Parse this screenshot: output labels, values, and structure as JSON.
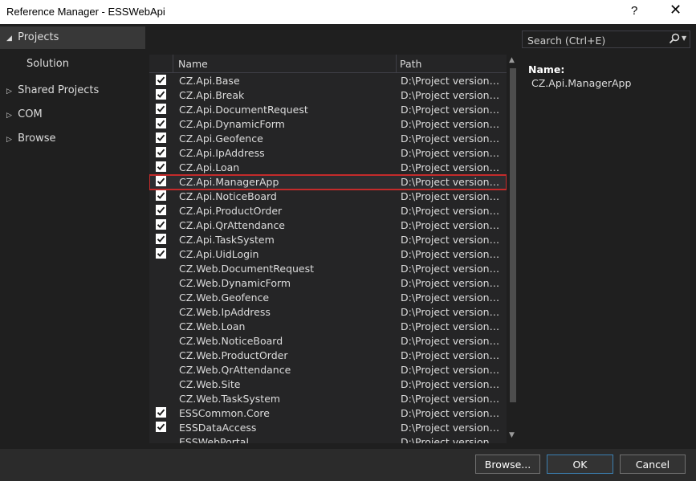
{
  "window": {
    "title": "Reference Manager - ESSWebApi",
    "help_glyph": "?",
    "close_glyph": "✕"
  },
  "sidebar": {
    "items": [
      {
        "label": "Projects",
        "expanded": true
      },
      {
        "label": "Solution"
      },
      {
        "label": "Shared Projects",
        "expanded": false
      },
      {
        "label": "COM",
        "expanded": false
      },
      {
        "label": "Browse",
        "expanded": false
      }
    ]
  },
  "search": {
    "placeholder": "Search (Ctrl+E)"
  },
  "grid": {
    "columns": {
      "name": "Name",
      "path": "Path"
    },
    "rows": [
      {
        "name": "CZ.Api.Base",
        "path": "D:\\Project versions\\...",
        "checked": true
      },
      {
        "name": "CZ.Api.Break",
        "path": "D:\\Project versions\\...",
        "checked": true
      },
      {
        "name": "CZ.Api.DocumentRequest",
        "path": "D:\\Project versions\\...",
        "checked": true
      },
      {
        "name": "CZ.Api.DynamicForm",
        "path": "D:\\Project versions\\...",
        "checked": true
      },
      {
        "name": "CZ.Api.Geofence",
        "path": "D:\\Project versions\\...",
        "checked": true
      },
      {
        "name": "CZ.Api.IpAddress",
        "path": "D:\\Project versions\\...",
        "checked": true
      },
      {
        "name": "CZ.Api.Loan",
        "path": "D:\\Project versions\\...",
        "checked": true
      },
      {
        "name": "CZ.Api.ManagerApp",
        "path": "D:\\Project versions\\...",
        "checked": true,
        "selected": true
      },
      {
        "name": "CZ.Api.NoticeBoard",
        "path": "D:\\Project versions\\...",
        "checked": true
      },
      {
        "name": "CZ.Api.ProductOrder",
        "path": "D:\\Project versions\\...",
        "checked": true
      },
      {
        "name": "CZ.Api.QrAttendance",
        "path": "D:\\Project versions\\...",
        "checked": true
      },
      {
        "name": "CZ.Api.TaskSystem",
        "path": "D:\\Project versions\\...",
        "checked": true
      },
      {
        "name": "CZ.Api.UidLogin",
        "path": "D:\\Project versions\\...",
        "checked": true
      },
      {
        "name": "CZ.Web.DocumentRequest",
        "path": "D:\\Project versions\\...",
        "checked": false
      },
      {
        "name": "CZ.Web.DynamicForm",
        "path": "D:\\Project versions\\...",
        "checked": false
      },
      {
        "name": "CZ.Web.Geofence",
        "path": "D:\\Project versions\\...",
        "checked": false
      },
      {
        "name": "CZ.Web.IpAddress",
        "path": "D:\\Project versions\\...",
        "checked": false
      },
      {
        "name": "CZ.Web.Loan",
        "path": "D:\\Project versions\\...",
        "checked": false
      },
      {
        "name": "CZ.Web.NoticeBoard",
        "path": "D:\\Project versions\\...",
        "checked": false
      },
      {
        "name": "CZ.Web.ProductOrder",
        "path": "D:\\Project versions\\...",
        "checked": false
      },
      {
        "name": "CZ.Web.QrAttendance",
        "path": "D:\\Project versions\\...",
        "checked": false
      },
      {
        "name": "CZ.Web.Site",
        "path": "D:\\Project versions\\...",
        "checked": false
      },
      {
        "name": "CZ.Web.TaskSystem",
        "path": "D:\\Project versions\\...",
        "checked": false
      },
      {
        "name": "ESSCommon.Core",
        "path": "D:\\Project versions\\...",
        "checked": true
      },
      {
        "name": "ESSDataAccess",
        "path": "D:\\Project versions\\...",
        "checked": true
      },
      {
        "name": "ESSWebPortal",
        "path": "D:\\Project versions\\...",
        "checked": false
      }
    ]
  },
  "details": {
    "name_label": "Name:",
    "name_value": "CZ.Api.ManagerApp"
  },
  "buttons": {
    "browse": "Browse...",
    "ok": "OK",
    "cancel": "Cancel"
  },
  "colors": {
    "selection_outline": "#c42b2b",
    "ok_border": "#3c7fb1"
  }
}
